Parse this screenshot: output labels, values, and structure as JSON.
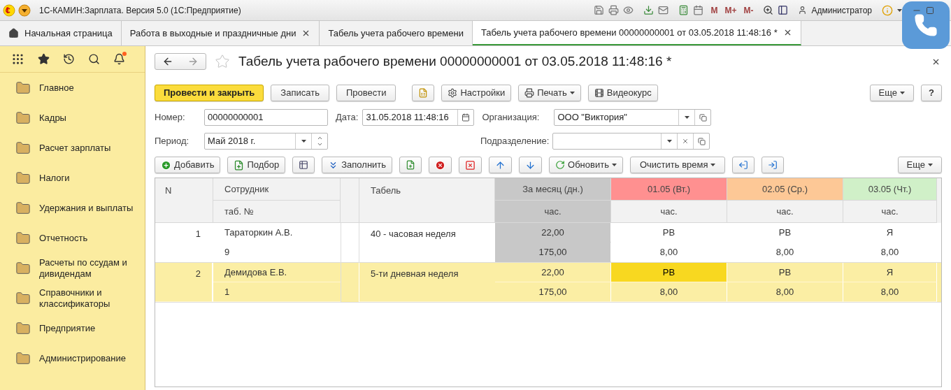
{
  "window": {
    "title": "1С-КАМИН:Зарплата. Версия 5.0  (1С:Предприятие)",
    "memory_buttons": [
      "M",
      "M+",
      "M-"
    ],
    "user": "Администратор"
  },
  "tabs": [
    {
      "label": "Начальная страница",
      "kind": "home",
      "selected": false
    },
    {
      "label": "Работа в выходные и праздничные дни",
      "kind": "closable",
      "selected": false
    },
    {
      "label": "Табель учета рабочего времени",
      "kind": "plain",
      "selected": false
    },
    {
      "label": "Табель учета рабочего времени 00000000001 от 03.05.2018 11:48:16 *",
      "kind": "closable",
      "selected": true
    }
  ],
  "sidebar": {
    "notification": true,
    "items": [
      {
        "label": "Главное"
      },
      {
        "label": "Кадры"
      },
      {
        "label": "Расчет зарплаты"
      },
      {
        "label": "Налоги"
      },
      {
        "label": "Удержания и выплаты"
      },
      {
        "label": "Отчетность"
      },
      {
        "label": "Расчеты по ссудам и дивидендам"
      },
      {
        "label": "Справочники и классификаторы"
      },
      {
        "label": "Предприятие"
      },
      {
        "label": "Администрирование"
      }
    ]
  },
  "document": {
    "title": "Табель учета рабочего времени 00000000001 от 03.05.2018 11:48:16 *",
    "commands": [
      {
        "label": "Провести и закрыть",
        "kind": "primary"
      },
      {
        "label": "Записать",
        "kind": "plain"
      },
      {
        "label": "Провести",
        "kind": "plain"
      },
      {
        "kind": "icon"
      },
      {
        "label": "Настройки",
        "kind": "settings"
      },
      {
        "label": "Печать",
        "kind": "print"
      },
      {
        "label": "Видеокурс",
        "kind": "video"
      }
    ],
    "more": "Еще",
    "help": "?",
    "number": {
      "label": "Номер:",
      "value": "00000000001"
    },
    "date": {
      "label": "Дата:",
      "value": "31.05.2018 11:48:16"
    },
    "organization": {
      "label": "Организация:",
      "value": "ООО \"Виктория\""
    },
    "period": {
      "label": "Период:",
      "value": "Май 2018 г."
    },
    "department": {
      "label": "Подразделение:"
    }
  },
  "table_toolbar": {
    "add": "Добавить",
    "pick": "Подбор",
    "fill": "Заполнить",
    "refresh": "Обновить",
    "clear_time": "Очистить время",
    "more": "Еще"
  },
  "table": {
    "columns": {
      "n": "N",
      "employee": "Сотрудник",
      "tab_no": "таб. №",
      "schedule": "Табель",
      "month": "За месяц (дн.)",
      "month_unit": "час."
    },
    "days": [
      {
        "label": "01.05 (Вт.)",
        "unit": "час.",
        "color": "#ff9090"
      },
      {
        "label": "02.05 (Ср.)",
        "unit": "час.",
        "color": "#fdc896"
      },
      {
        "label": "03.05 (Чт.)",
        "unit": "час.",
        "color": "#d0f0c8"
      }
    ],
    "rows": [
      {
        "n": "1",
        "employee": "Тараторкин А.В.",
        "tab_no": "9",
        "schedule": "40 - часовая неделя",
        "month_days": "22,00",
        "month_hours": "175,00",
        "selected": false,
        "days": [
          {
            "code": "РВ",
            "hours": "8,00",
            "selected": false
          },
          {
            "code": "РВ",
            "hours": "8,00",
            "selected": false
          },
          {
            "code": "Я",
            "hours": "8,00",
            "selected": false
          }
        ]
      },
      {
        "n": "2",
        "employee": "Демидова Е.В.",
        "tab_no": "1",
        "schedule": "5-ти дневная неделя",
        "month_days": "22,00",
        "month_hours": "175,00",
        "selected": true,
        "days": [
          {
            "code": "РВ",
            "hours": "8,00",
            "selected": true
          },
          {
            "code": "РВ",
            "hours": "8,00",
            "selected": false
          },
          {
            "code": "Я",
            "hours": "8,00",
            "selected": false
          }
        ]
      }
    ]
  }
}
